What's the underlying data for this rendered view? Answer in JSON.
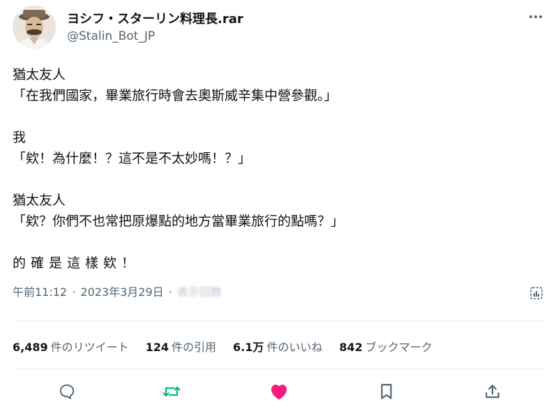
{
  "author": {
    "display_name": "ヨシフ・スターリン料理長.rar",
    "handle": "@Stalin_Bot_JP"
  },
  "tweet": {
    "lines": [
      "猶太友人",
      "「在我們國家，畢業旅行時會去奧斯威辛集中營參觀。」",
      "我",
      "「欸！為什麼！？這不是不太妙嗎！？」",
      "猶太友人",
      "「欸？你們不也常把原爆點的地方當畢業旅行的點嗎？」",
      "的確是這樣欸！"
    ]
  },
  "meta": {
    "time": "午前11:12",
    "date": "2023年3月29日",
    "separator": "·",
    "views": "表示回数"
  },
  "stats": {
    "retweets": {
      "count": "6,489",
      "label": "件のリツイート"
    },
    "quotes": {
      "count": "124",
      "label": "件の引用"
    },
    "likes": {
      "count": "6.1万",
      "label": "件のいいね"
    },
    "bookmarks": {
      "count": "842",
      "label": "ブックマーク"
    }
  },
  "colors": {
    "text": "#0f1419",
    "secondary": "#536471",
    "retweet": "#00ba7c",
    "like": "#f91880",
    "divider": "#eff3f4"
  },
  "icons": {
    "more": "more-dots-icon",
    "analytics": "analytics-icon",
    "reply": "reply-bubble-icon",
    "retweet": "retweet-arrows-icon",
    "like": "heart-icon",
    "bookmark": "bookmark-icon",
    "share": "share-upload-icon"
  }
}
